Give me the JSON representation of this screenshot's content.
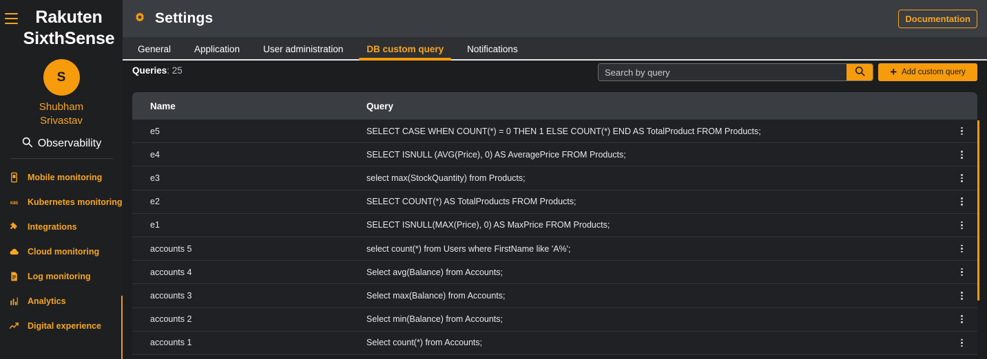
{
  "sidebar": {
    "hamburger_icon": "hamburger-menu-icon",
    "brand_line1": "Rakuten",
    "brand_line2": "SixthSense",
    "avatar_initial": "S",
    "user_first_name": "Shubham",
    "user_last_name": "Srivastav",
    "section_label": "Observability",
    "section_icon": "search-circle-icon",
    "items": [
      {
        "label": "Mobile monitoring",
        "icon": "mobile-icon"
      },
      {
        "label": "Kubernetes monitoring",
        "icon": "k8s-icon"
      },
      {
        "label": "Integrations",
        "icon": "puzzle-icon"
      },
      {
        "label": "Cloud monitoring",
        "icon": "cloud-icon"
      },
      {
        "label": "Log monitoring",
        "icon": "document-icon"
      },
      {
        "label": "Analytics",
        "icon": "bar-chart-icon"
      },
      {
        "label": "Digital experience",
        "icon": "trend-arrow-icon"
      }
    ]
  },
  "header": {
    "title": "Settings",
    "gear_icon": "gear-icon",
    "documentation_label": "Documentation"
  },
  "tabs": [
    {
      "label": "General",
      "active": false
    },
    {
      "label": "Application",
      "active": false
    },
    {
      "label": "User administration",
      "active": false
    },
    {
      "label": "DB custom query",
      "active": true
    },
    {
      "label": "Notifications",
      "active": false
    }
  ],
  "toolbar": {
    "queries_label": "Queries",
    "queries_separator": ": ",
    "queries_count": "25",
    "search_placeholder": "Search by query",
    "search_value": "",
    "search_icon": "magnifier-icon",
    "add_button_label": "Add custom query",
    "add_button_icon": "plus-icon"
  },
  "table": {
    "columns": [
      "Name",
      "Query"
    ],
    "rows": [
      {
        "name": "e5",
        "query": "SELECT CASE WHEN COUNT(*) = 0 THEN 1 ELSE COUNT(*) END AS TotalProduct FROM Products;"
      },
      {
        "name": "e4",
        "query": "SELECT ISNULL (AVG(Price), 0) AS AveragePrice FROM Products;"
      },
      {
        "name": "e3",
        "query": "select max(StockQuantity) from Products;"
      },
      {
        "name": "e2",
        "query": "SELECT COUNT(*) AS TotalProducts FROM Products;"
      },
      {
        "name": "e1",
        "query": "SELECT ISNULL(MAX(Price), 0) AS MaxPrice FROM Products;"
      },
      {
        "name": "accounts 5",
        "query": "select count(*) from Users where FirstName like 'A%';"
      },
      {
        "name": "accounts 4",
        "query": "Select avg(Balance) from Accounts;"
      },
      {
        "name": "accounts 3",
        "query": "Select max(Balance) from Accounts;"
      },
      {
        "name": "accounts 2",
        "query": "Select min(Balance) from Accounts;"
      },
      {
        "name": "accounts 1",
        "query": "Select count(*) from Accounts;"
      }
    ]
  },
  "colors": {
    "accent": "#f59b0c",
    "accent_text": "#f5a623",
    "sidebar_bg": "#1e1f21",
    "panel_bg": "#1b1d1f",
    "header_bg": "#3a3d41",
    "tabs_bg": "#2e3033",
    "row_bg": "#1f2124",
    "text": "#ffffff"
  }
}
